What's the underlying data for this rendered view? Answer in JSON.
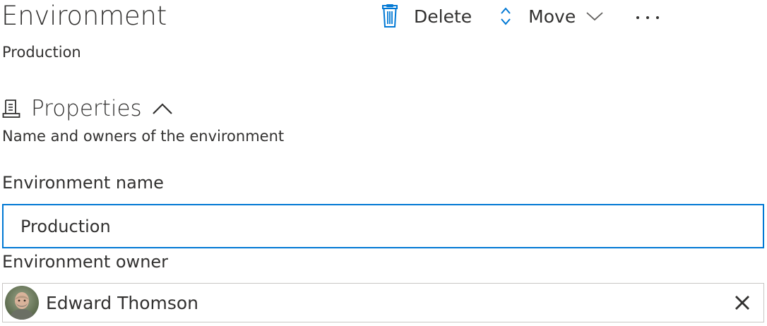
{
  "header": {
    "title": "Environment",
    "subtitle": "Production"
  },
  "toolbar": {
    "delete_label": "Delete",
    "move_label": "Move"
  },
  "section": {
    "title": "Properties",
    "description": "Name and owners of the environment"
  },
  "form": {
    "name_label": "Environment name",
    "name_value": "Production",
    "owner_label": "Environment owner",
    "owner_name": "Edward Thomson"
  },
  "colors": {
    "accent": "#0078d4",
    "text": "#323130"
  },
  "icons": {
    "delete": "trash-icon",
    "move": "up-down-arrows-icon",
    "move_menu": "chevron-down-icon",
    "more": "more-ellipsis-icon",
    "section": "document-properties-icon",
    "collapse": "chevron-up-icon",
    "clear": "close-icon"
  }
}
